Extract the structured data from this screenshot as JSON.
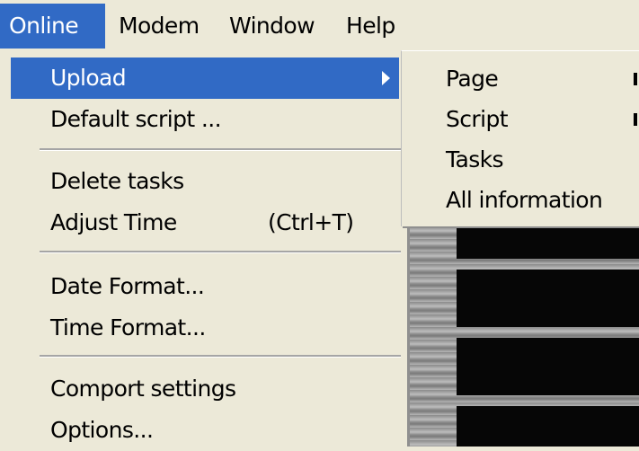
{
  "menubar": {
    "items": [
      "Online",
      "Modem",
      "Window",
      "Help"
    ],
    "active": "Online"
  },
  "dropdown": {
    "items": [
      {
        "label": "Upload",
        "has_submenu": true,
        "highlighted": true
      },
      {
        "label": "Default script ..."
      },
      {
        "label": "Delete tasks"
      },
      {
        "label": "Adjust Time",
        "shortcut": "(Ctrl+T)"
      },
      {
        "label": "Date Format..."
      },
      {
        "label": "Time Format..."
      },
      {
        "label": "Comport settings"
      },
      {
        "label": "Options..."
      }
    ]
  },
  "submenu": {
    "items": [
      {
        "label": "Page",
        "has_submenu": true
      },
      {
        "label": "Script",
        "has_submenu": true
      },
      {
        "label": "Tasks"
      },
      {
        "label": "All information"
      }
    ]
  },
  "colors": {
    "highlight": "#316ac5",
    "menu_background": "#ece9d8",
    "app_dark": "#060606"
  },
  "icons": {
    "submenu_indicator": "chevron-right-icon"
  }
}
